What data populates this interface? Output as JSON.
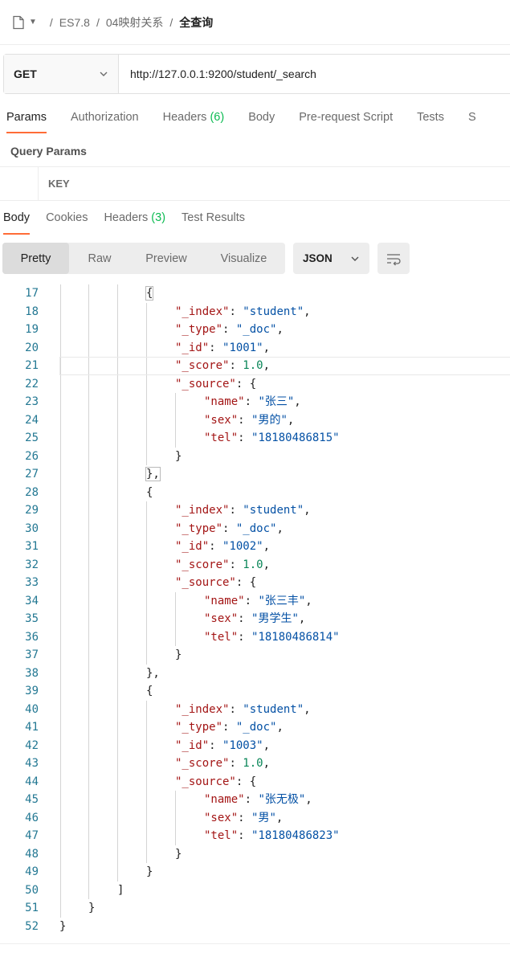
{
  "breadcrumb": {
    "items": [
      "ES7.8",
      "04映射关系"
    ],
    "current": "全查询",
    "separator": "/"
  },
  "request": {
    "method": "GET",
    "url": "http://127.0.0.1:9200/student/_search"
  },
  "request_tabs": [
    {
      "label": "Params",
      "count": "",
      "active": true
    },
    {
      "label": "Authorization",
      "count": "",
      "active": false
    },
    {
      "label": "Headers",
      "count": "(6)",
      "active": false
    },
    {
      "label": "Body",
      "count": "",
      "active": false
    },
    {
      "label": "Pre-request Script",
      "count": "",
      "active": false
    },
    {
      "label": "Tests",
      "count": "",
      "active": false
    },
    {
      "label": "S",
      "count": "",
      "active": false
    }
  ],
  "params": {
    "section_title": "Query Params",
    "key_header": "KEY"
  },
  "response_tabs": [
    {
      "label": "Body",
      "count": "",
      "active": true
    },
    {
      "label": "Cookies",
      "count": "",
      "active": false
    },
    {
      "label": "Headers",
      "count": "(3)",
      "active": false
    },
    {
      "label": "Test Results",
      "count": "",
      "active": false
    }
  ],
  "view_modes": [
    "Pretty",
    "Raw",
    "Preview",
    "Visualize"
  ],
  "active_view": "Pretty",
  "format": "JSON",
  "code_lines": [
    {
      "n": "17",
      "indent": 3,
      "text": "{"
    },
    {
      "n": "18",
      "indent": 4,
      "key": "_index",
      "val": "\"student\"",
      "type": "s",
      "comma": true
    },
    {
      "n": "19",
      "indent": 4,
      "key": "_type",
      "val": "\"_doc\"",
      "type": "s",
      "comma": true
    },
    {
      "n": "20",
      "indent": 4,
      "key": "_id",
      "val": "\"1001\"",
      "type": "s",
      "comma": true
    },
    {
      "n": "21",
      "indent": 4,
      "key": "_score",
      "val": "1.0",
      "type": "n",
      "comma": true
    },
    {
      "n": "22",
      "indent": 4,
      "key": "_source",
      "val": "{",
      "type": "p",
      "comma": false
    },
    {
      "n": "23",
      "indent": 5,
      "key": "name",
      "val": "\"张三\"",
      "type": "s",
      "comma": true
    },
    {
      "n": "24",
      "indent": 5,
      "key": "sex",
      "val": "\"男的\"",
      "type": "s",
      "comma": true
    },
    {
      "n": "25",
      "indent": 5,
      "key": "tel",
      "val": "\"18180486815\"",
      "type": "s",
      "comma": false
    },
    {
      "n": "26",
      "indent": 4,
      "text": "}"
    },
    {
      "n": "27",
      "indent": 3,
      "text": "},"
    },
    {
      "n": "28",
      "indent": 3,
      "text": "{"
    },
    {
      "n": "29",
      "indent": 4,
      "key": "_index",
      "val": "\"student\"",
      "type": "s",
      "comma": true
    },
    {
      "n": "30",
      "indent": 4,
      "key": "_type",
      "val": "\"_doc\"",
      "type": "s",
      "comma": true
    },
    {
      "n": "31",
      "indent": 4,
      "key": "_id",
      "val": "\"1002\"",
      "type": "s",
      "comma": true
    },
    {
      "n": "32",
      "indent": 4,
      "key": "_score",
      "val": "1.0",
      "type": "n",
      "comma": true
    },
    {
      "n": "33",
      "indent": 4,
      "key": "_source",
      "val": "{",
      "type": "p",
      "comma": false
    },
    {
      "n": "34",
      "indent": 5,
      "key": "name",
      "val": "\"张三丰\"",
      "type": "s",
      "comma": true
    },
    {
      "n": "35",
      "indent": 5,
      "key": "sex",
      "val": "\"男学生\"",
      "type": "s",
      "comma": true
    },
    {
      "n": "36",
      "indent": 5,
      "key": "tel",
      "val": "\"18180486814\"",
      "type": "s",
      "comma": false
    },
    {
      "n": "37",
      "indent": 4,
      "text": "}"
    },
    {
      "n": "38",
      "indent": 3,
      "text": "},"
    },
    {
      "n": "39",
      "indent": 3,
      "text": "{"
    },
    {
      "n": "40",
      "indent": 4,
      "key": "_index",
      "val": "\"student\"",
      "type": "s",
      "comma": true
    },
    {
      "n": "41",
      "indent": 4,
      "key": "_type",
      "val": "\"_doc\"",
      "type": "s",
      "comma": true
    },
    {
      "n": "42",
      "indent": 4,
      "key": "_id",
      "val": "\"1003\"",
      "type": "s",
      "comma": true
    },
    {
      "n": "43",
      "indent": 4,
      "key": "_score",
      "val": "1.0",
      "type": "n",
      "comma": true
    },
    {
      "n": "44",
      "indent": 4,
      "key": "_source",
      "val": "{",
      "type": "p",
      "comma": false
    },
    {
      "n": "45",
      "indent": 5,
      "key": "name",
      "val": "\"张无极\"",
      "type": "s",
      "comma": true
    },
    {
      "n": "46",
      "indent": 5,
      "key": "sex",
      "val": "\"男\"",
      "type": "s",
      "comma": true
    },
    {
      "n": "47",
      "indent": 5,
      "key": "tel",
      "val": "\"18180486823\"",
      "type": "s",
      "comma": false
    },
    {
      "n": "48",
      "indent": 4,
      "text": "}"
    },
    {
      "n": "49",
      "indent": 3,
      "text": "}"
    },
    {
      "n": "50",
      "indent": 2,
      "text": "]"
    },
    {
      "n": "51",
      "indent": 1,
      "text": "}"
    },
    {
      "n": "52",
      "indent": 0,
      "text": "}"
    }
  ],
  "colors": {
    "accent": "#ff6c37",
    "count": "#0cbb52",
    "json_key": "#a31515",
    "json_string": "#0451a5",
    "json_number": "#098658",
    "line_number": "#237893"
  }
}
